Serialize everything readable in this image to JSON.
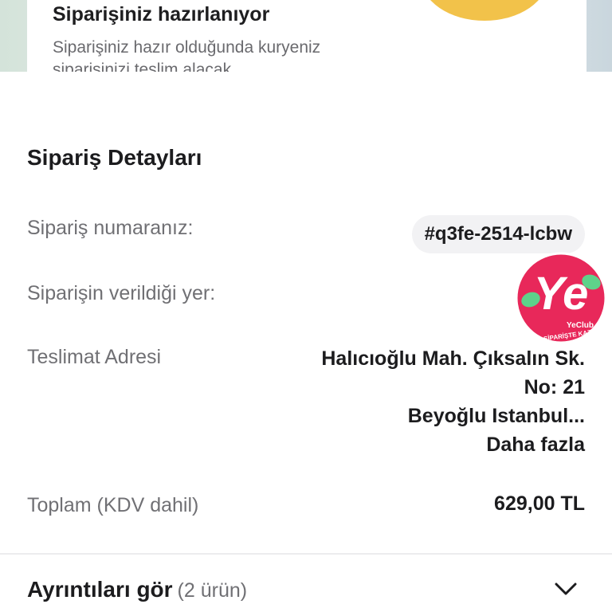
{
  "status": {
    "title": "Siparişiniz hazırlanıyor",
    "description": "Siparişiniz hazır olduğunda kuryeniz siparişinizi teslim alacak."
  },
  "details": {
    "title": "Sipariş Detayları",
    "order_number_label": "Sipariş numaranız:",
    "order_number": "#q3fe-2514-lcbw",
    "placed_at_label": "Siparişin verildiği yer:",
    "address_label": "Teslimat Adresi",
    "address_lines": [
      "Halıcıoğlu Mah. Çıksalın Sk.",
      "No: 21",
      "Beyoğlu Istanbul..."
    ],
    "more_link": "Daha fazla",
    "total_label": "Toplam (KDV dahil)",
    "total_value": "629,00 TL"
  },
  "items_toggle": {
    "label": "Ayrıntıları gör",
    "count": "(2 ürün)"
  },
  "badge": {
    "brand_text": "Ye",
    "name": "YeClub",
    "slogan": "HER SİPARİŞTE KAZAN!",
    "colors": {
      "primary": "#e8285a",
      "accent": "#5ed28a"
    }
  },
  "icons": {
    "expand": "chevron-down-icon"
  }
}
